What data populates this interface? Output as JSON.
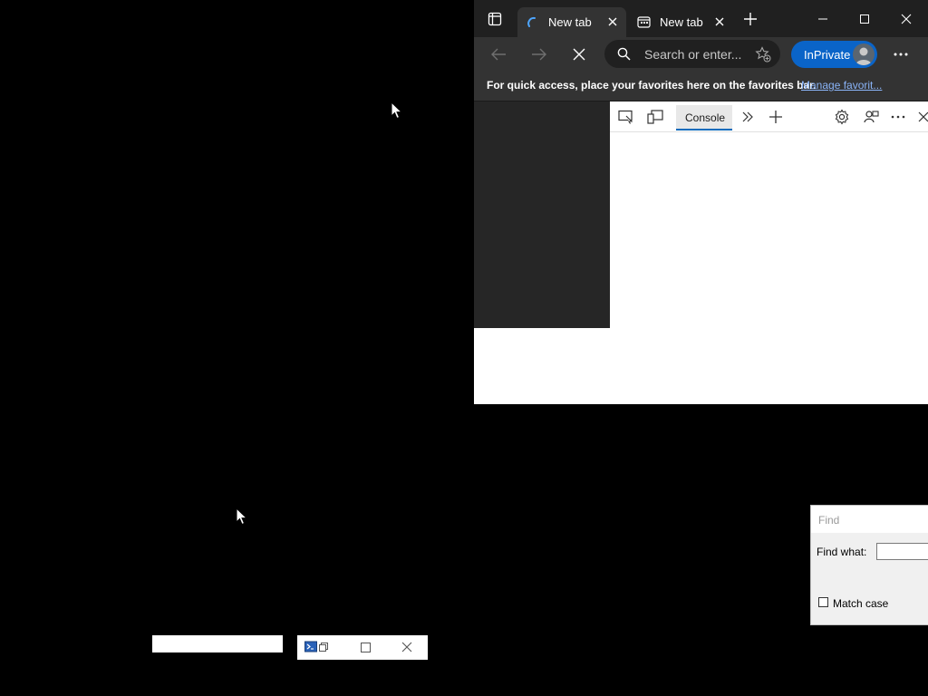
{
  "browser": {
    "tabs": [
      {
        "label": "New tab",
        "state": "loading"
      },
      {
        "label": "New tab",
        "state": "loaded"
      }
    ],
    "address_bar": {
      "placeholder": "Search or enter..."
    },
    "inprivate_label": "InPrivate",
    "favorites_bar": {
      "message": "For quick access, place your favorites here on the favorites bar.",
      "link": "Manage favorit..."
    },
    "devtools": {
      "active_tab": "Console"
    }
  },
  "find_dialog": {
    "title": "Find",
    "find_what_label": "Find what:",
    "find_what_value": "",
    "match_case_label": "Match case",
    "match_case_checked": false
  },
  "colors": {
    "desktop": "#000000",
    "tab_strip": "#202020",
    "toolbar": "#333333",
    "inprivate": "#0a64c8",
    "link": "#8ab4f8"
  }
}
